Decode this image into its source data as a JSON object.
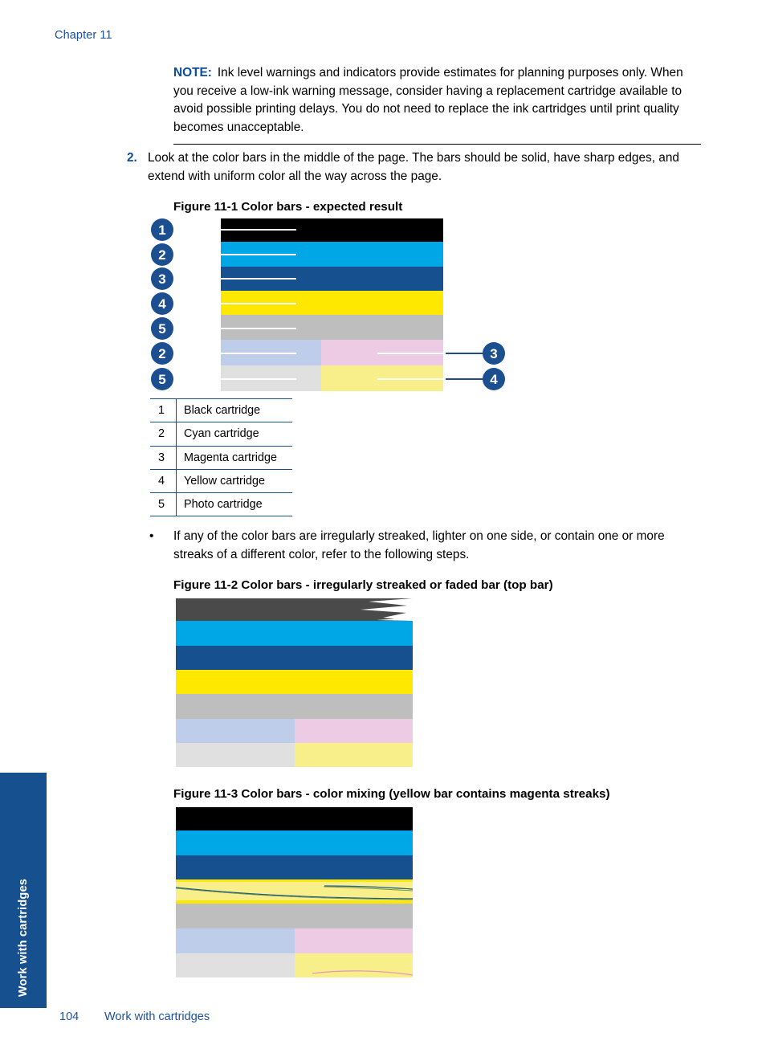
{
  "chapter": {
    "label": "Chapter 11"
  },
  "side_tab": {
    "label": "Work with cartridges"
  },
  "note": {
    "label": "NOTE:",
    "text": "Ink level warnings and indicators provide estimates for planning purposes only. When you receive a low-ink warning message, consider having a replacement cartridge available to avoid possible printing delays. You do not need to replace the ink cartridges until print quality becomes unacceptable."
  },
  "step": {
    "number": "2.",
    "text": "Look at the color bars in the middle of the page. The bars should be solid, have sharp edges, and extend with uniform color all the way across the page."
  },
  "figures": {
    "fig1_caption": "Figure 11-1 Color bars - expected result",
    "fig2_caption": "Figure 11-2 Color bars - irregularly streaked or faded bar (top bar)",
    "fig3_caption": "Figure 11-3 Color bars - color mixing (yellow bar contains magenta streaks)"
  },
  "bullet": {
    "dot": "•",
    "text": "If any of the color bars are irregularly streaked, lighter on one side, or contain one or more streaks of a different color, refer to the following steps."
  },
  "legend": {
    "rows": [
      {
        "num": "1",
        "label": "Black cartridge"
      },
      {
        "num": "2",
        "label": "Cyan cartridge"
      },
      {
        "num": "3",
        "label": "Magenta cartridge"
      },
      {
        "num": "4",
        "label": "Yellow cartridge"
      },
      {
        "num": "5",
        "label": "Photo cartridge"
      }
    ]
  },
  "callouts": {
    "left": [
      "1",
      "2",
      "3",
      "4",
      "5",
      "2",
      "5"
    ],
    "right": [
      "3",
      "4"
    ]
  },
  "colors": {
    "black": "#000000",
    "cyan": "#00A7E7",
    "blue": "#17508F",
    "yellow": "#FFE800",
    "gray": "#BEBEBE",
    "light_blue": "#BDCDEA",
    "light_gray": "#E0E0E0",
    "pink": "#EDCBE5",
    "light_yellow": "#F8EF8A",
    "dark_gray_faded": "#4A4A4A",
    "callout_blue": "#1B4F8F",
    "accent_blue": "#1B5099",
    "note_blue": "#0B4C9E",
    "streak_dark": "#1B5E7E",
    "streak_magenta": "#E59BB8"
  },
  "footer": {
    "page_number": "104",
    "section": "Work with cartridges"
  }
}
